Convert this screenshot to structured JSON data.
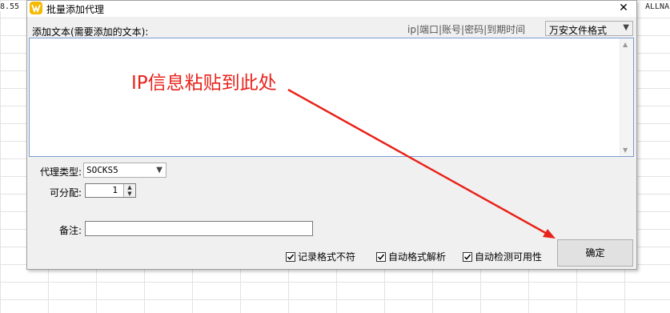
{
  "background": {
    "cell_left": "8.55",
    "cell_right": "ALLNA"
  },
  "dialog": {
    "title": "批量添加代理",
    "close_glyph": "✕",
    "add_text_label": "添加文本(需要添加的文本):",
    "field_hint": "ip|端口|账号|密码|到期时间",
    "format_select": "万安文件格式",
    "proxy_type_label": "代理类型:",
    "proxy_type_value": "SOCKS5",
    "allocate_label": "可分配:",
    "allocate_value": "1",
    "note_label": "备注:",
    "note_value": "",
    "checkboxes": [
      {
        "label": "记录格式不符",
        "checked": true
      },
      {
        "label": "自动格式解析",
        "checked": true
      },
      {
        "label": "自动检测可用性",
        "checked": true
      }
    ],
    "ok_button": "确定"
  },
  "annotation": {
    "text": "IP信息粘贴到此处",
    "color": "#e8231b"
  }
}
